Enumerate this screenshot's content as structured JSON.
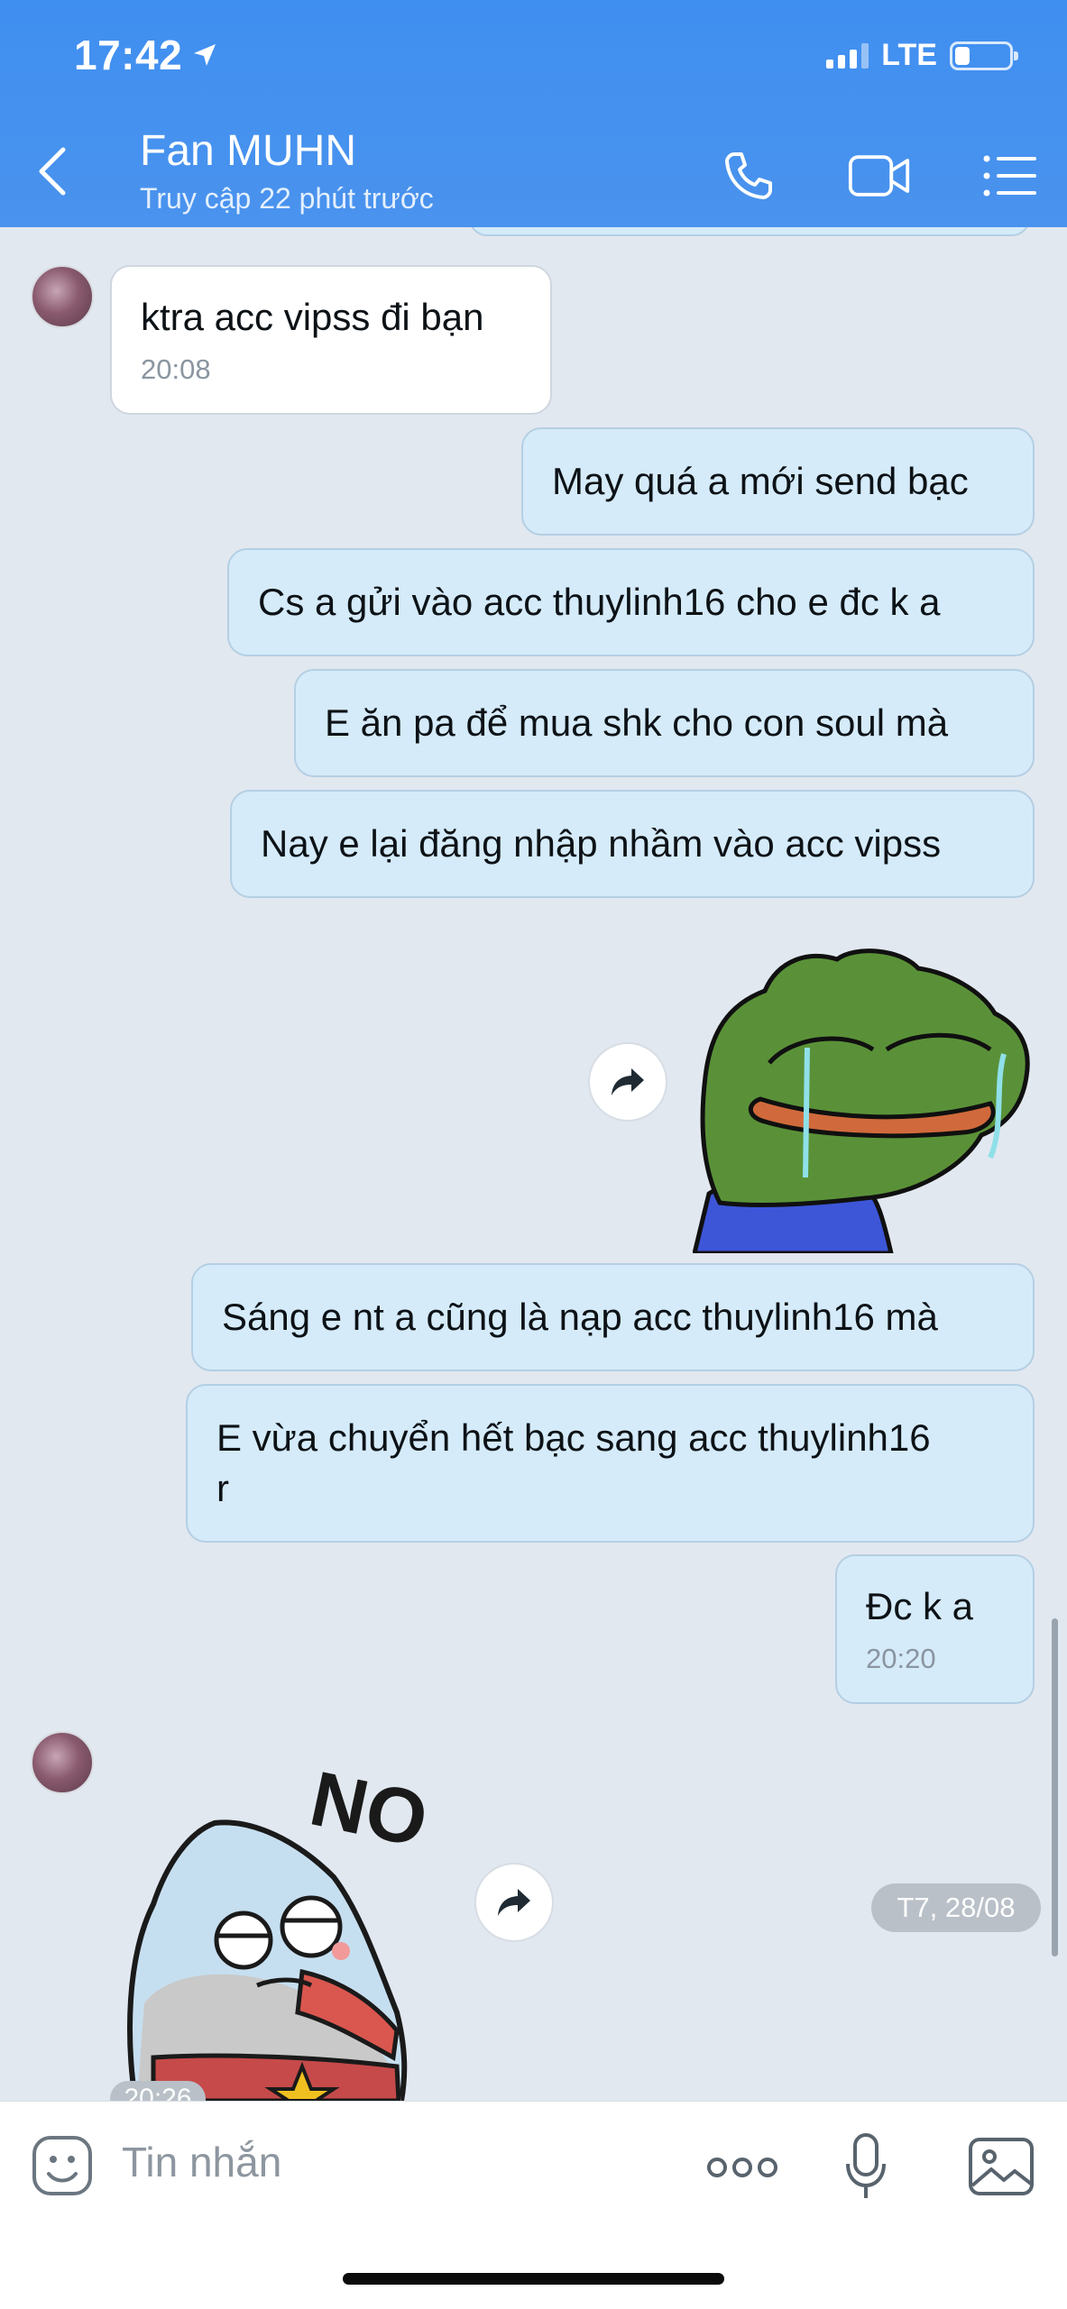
{
  "status_bar": {
    "time": "17:42",
    "network": "LTE",
    "battery_level": 0.2
  },
  "header": {
    "name": "Fan MUHN",
    "status": "Truy cập 22 phút trước"
  },
  "messages": [
    {
      "text": "ktra acc vipss đi bạn",
      "time": "20:08"
    },
    {
      "text": "May quá a mới send bạc"
    },
    {
      "text": "Cs a gửi vào acc thuylinh16 cho e đc k a"
    },
    {
      "text": "E ăn pa để mua shk cho con soul mà"
    },
    {
      "text": "Nay e lại đăng nhập nhầm vào acc vipss"
    },
    {
      "text": "Sáng e nt a cũng là nạp acc thuylinh16 mà"
    },
    {
      "text_line1": "E vừa chuyển hết bạc sang acc thuylinh16",
      "text_line2": "r"
    },
    {
      "text": "Đc k a",
      "time": "20:20"
    }
  ],
  "stickers": {
    "frog": "crying-frog-sticker",
    "shark": {
      "name": "shark-no-sticker",
      "caption": "NO"
    }
  },
  "date_chip": "T7, 28/08",
  "partial_time": "20:26",
  "composer": {
    "placeholder": "Tin nhắn"
  },
  "colors": {
    "header": "#4390ef",
    "outgoing_bubble": "#d5ebfa",
    "incoming_bubble": "#ffffff",
    "background": "#e2e8f0"
  }
}
